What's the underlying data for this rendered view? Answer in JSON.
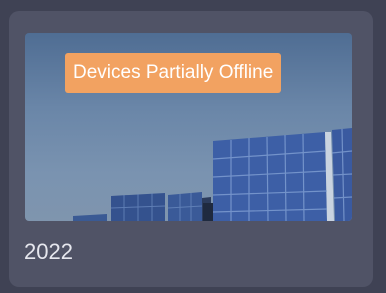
{
  "card": {
    "status_badge": "Devices Partially Offline",
    "year": "2022",
    "image_icon": "solar-panel-image"
  },
  "colors": {
    "page_bg": "#3f4254",
    "card_bg": "#505366",
    "badge_bg": "#f2a261",
    "badge_text": "#ffffff",
    "year_text": "#e6e7ee"
  }
}
